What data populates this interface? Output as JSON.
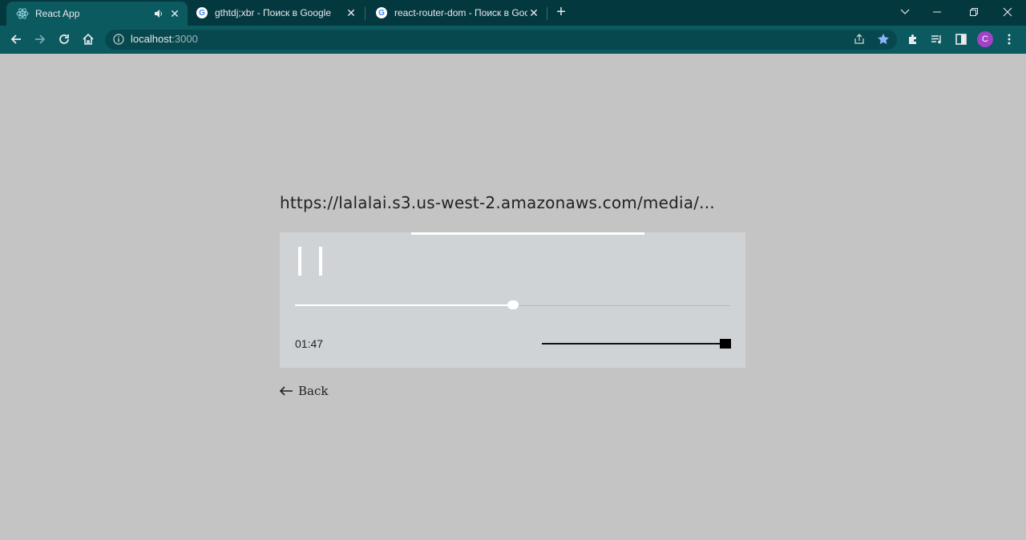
{
  "browser": {
    "tabs": [
      {
        "title": "React App",
        "active": true,
        "audio": true
      },
      {
        "title": "gthtdj;xbr - Поиск в Google",
        "active": false
      },
      {
        "title": "react-router-dom - Поиск в Google",
        "active": false
      }
    ],
    "address": {
      "host": "localhost",
      "port": ":3000"
    },
    "profile_initial": "C"
  },
  "player": {
    "track_url": "https://lalalai.s3.us-west-2.amazonaws.com/media/...",
    "state": "playing",
    "current_time": "01:47",
    "progress_fraction": 0.5,
    "volume_fraction": 1.0
  },
  "nav": {
    "back_label": "Back"
  },
  "colors": {
    "page_bg": "#c4c4c4",
    "player_bg": "#d0d3d6",
    "chrome": "#0b5a60",
    "accent": "#ffffff"
  }
}
